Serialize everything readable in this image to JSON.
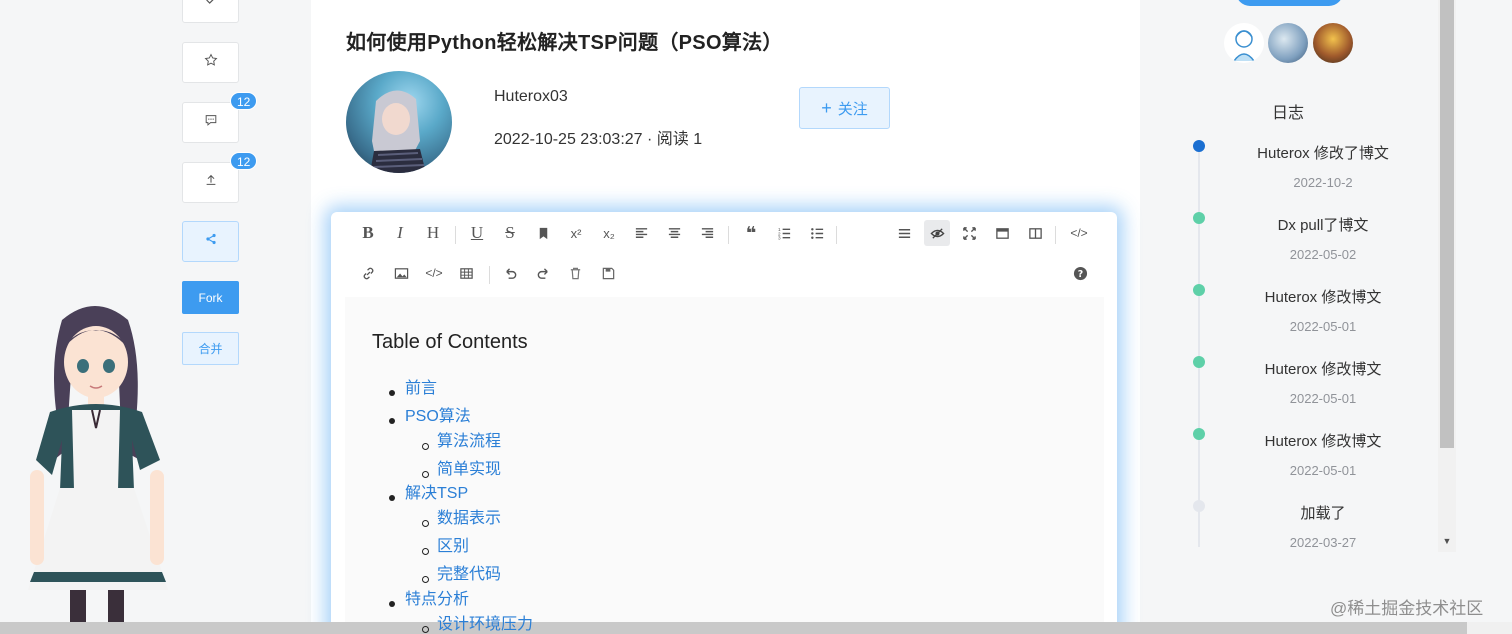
{
  "article": {
    "title": "如何使用Python轻松解决TSP问题（PSO算法）",
    "author": "Huterox03",
    "meta": "2022-10-25 23:03:27 · 阅读 1",
    "follow_label": "关注"
  },
  "actions": {
    "comment_count": "12",
    "share_count": "12",
    "fork_label": "Fork",
    "merge_label": "合并"
  },
  "editor": {
    "toc_title": "Table of Contents",
    "toc": [
      {
        "label": "前言",
        "level": 1
      },
      {
        "label": "PSO算法",
        "level": 1
      },
      {
        "label": "算法流程",
        "level": 2
      },
      {
        "label": "简单实现",
        "level": 2
      },
      {
        "label": "解决TSP",
        "level": 1
      },
      {
        "label": "数据表示",
        "level": 2
      },
      {
        "label": "区别",
        "level": 2
      },
      {
        "label": "完整代码",
        "level": 2
      },
      {
        "label": "特点分析",
        "level": 1
      },
      {
        "label": "设计环境压力",
        "level": 2
      }
    ]
  },
  "log": {
    "title": "日志",
    "items": [
      {
        "text": "Huterox 修改了博文",
        "date": "2022-10-2",
        "color": "#1b6fd1"
      },
      {
        "text": "Dx pull了博文",
        "date": "2022-05-02",
        "color": "#5ed0a8"
      },
      {
        "text": "Huterox 修改博文",
        "date": "2022-05-01",
        "color": "#5ed0a8"
      },
      {
        "text": "Huterox 修改博文",
        "date": "2022-05-01",
        "color": "#5ed0a8"
      },
      {
        "text": "Huterox 修改博文",
        "date": "2022-05-01",
        "color": "#5ed0a8"
      },
      {
        "text": "加载了",
        "date": "2022-03-27",
        "color": "#e4e7ed"
      }
    ]
  },
  "watermark": "@稀土掘金技术社区",
  "colors": {
    "accent": "#3d9bf0",
    "timeline_active": "#1b6fd1",
    "timeline_done": "#5ed0a8"
  }
}
